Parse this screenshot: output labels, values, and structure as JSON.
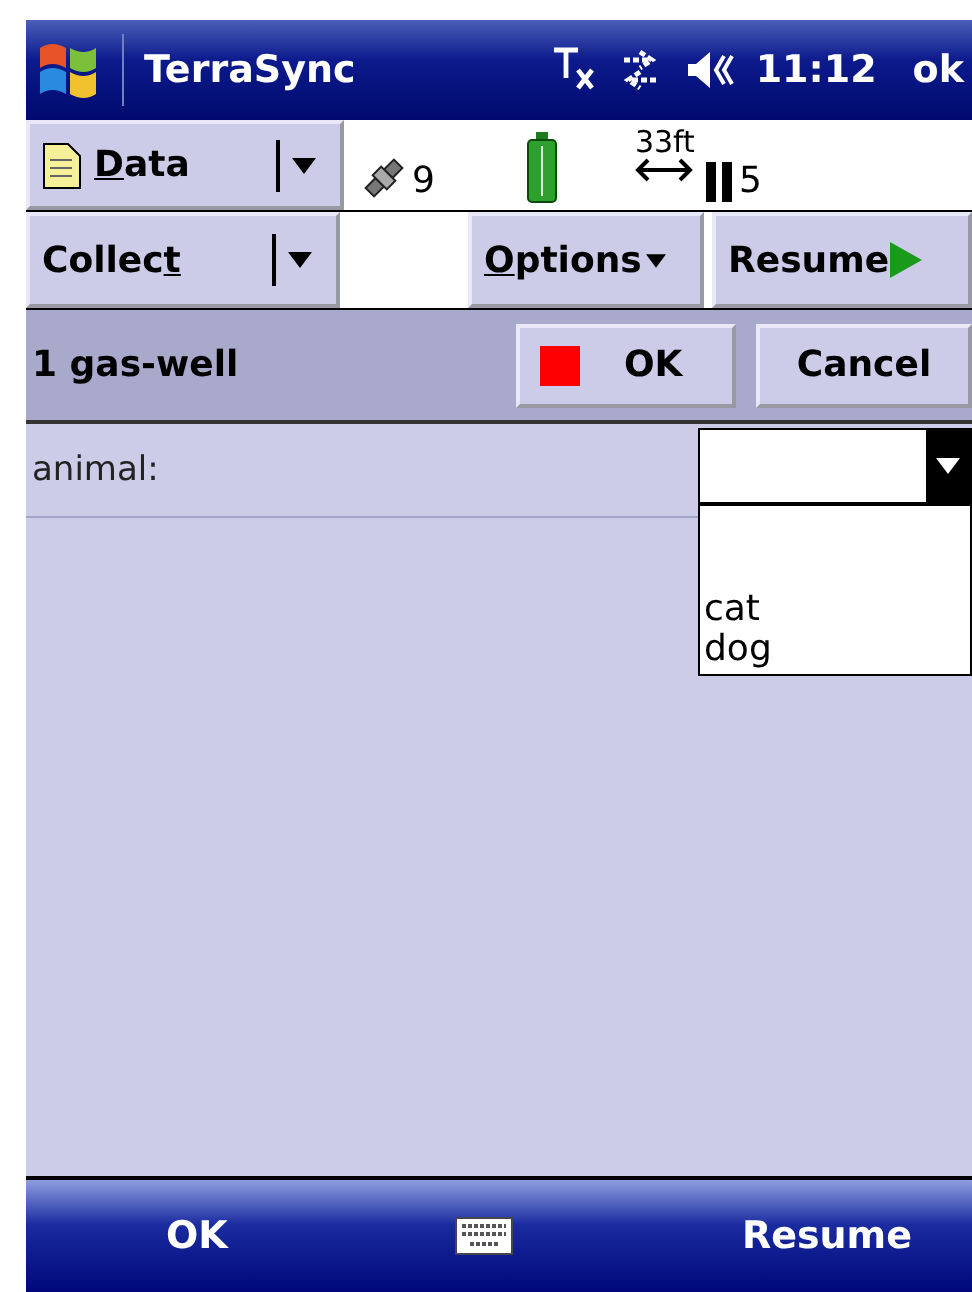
{
  "title_bar": {
    "app_name": "TerraSync",
    "time": "11:12",
    "ok": "ok"
  },
  "status_bar": {
    "satellites": "9",
    "accuracy": "33ft",
    "pdop": "5"
  },
  "section_button": {
    "key": "D",
    "after": "ata"
  },
  "mode_button": {
    "before": "Collec",
    "key": "t"
  },
  "options_button": {
    "key": "O",
    "after": "ptions"
  },
  "resume_button": {
    "label": "Resume"
  },
  "feature_header": {
    "title": "1 gas-well",
    "ok": "OK",
    "cancel": "Cancel"
  },
  "form": {
    "fields": [
      {
        "label": "animal:",
        "value_open": true,
        "options": [
          "cat",
          "dog"
        ]
      }
    ]
  },
  "softkeys": {
    "left": "OK",
    "right": "Resume"
  }
}
